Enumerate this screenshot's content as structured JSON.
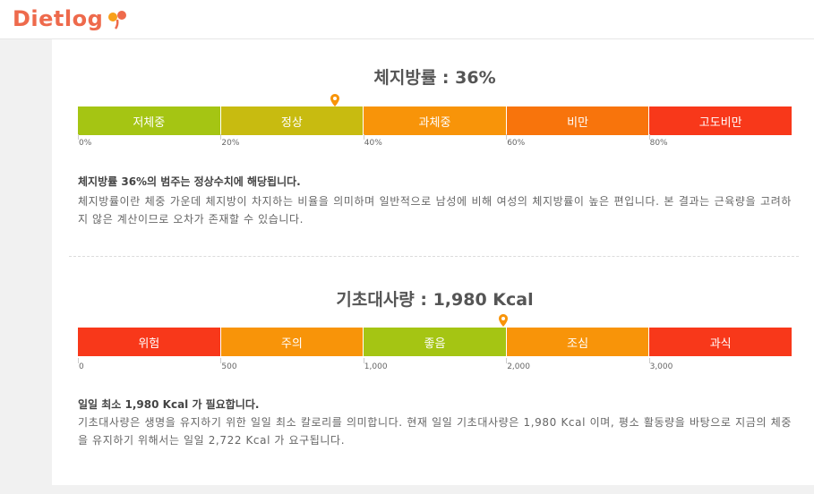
{
  "header": {
    "logo_text": "Dietlog"
  },
  "body_fat": {
    "title": "체지방률 : 36%",
    "marker_value": 36,
    "segments": [
      {
        "label": "저체중",
        "color": "#a5c513"
      },
      {
        "label": "정상",
        "color": "#c8bb10"
      },
      {
        "label": "과체중",
        "color": "#f89409"
      },
      {
        "label": "비만",
        "color": "#f8740c"
      },
      {
        "label": "고도비만",
        "color": "#f8381a"
      }
    ],
    "ticks": [
      "0%",
      "20%",
      "40%",
      "60%",
      "80%"
    ],
    "summary": "체지방률 36%의 범주는 정상수치에 해당됩니다.",
    "description": "체지방률이란 체중 가운데 체지방이 차지하는 비율을 의미하며 일반적으로 남성에 비해 여성의 체지방률이 높은 편입니다. 본 결과는 근육량을 고려하지 않은 계산이므로 오차가 존재할 수 있습니다."
  },
  "bmr": {
    "title": "기초대사량 : 1,980 Kcal",
    "marker_value": 1980,
    "segments": [
      {
        "label": "위험",
        "color": "#f8381a"
      },
      {
        "label": "주의",
        "color": "#f89409"
      },
      {
        "label": "좋음",
        "color": "#a5c513"
      },
      {
        "label": "조심",
        "color": "#f89409"
      },
      {
        "label": "과식",
        "color": "#f8381a"
      }
    ],
    "ticks": [
      "0",
      "500",
      "1,000",
      "2,000",
      "3,000"
    ],
    "summary": "일일 최소 1,980 Kcal 가 필요합니다.",
    "description": "기초대사량은 생명을 유지하기 위한 일일 최소 칼로리를 의미합니다. 현재 일일 기초대사량은 1,980 Kcal 이며, 평소 활동량을 바탕으로 지금의 체중을 유지하기 위해서는 일일 2,722 Kcal 가 요구됩니다."
  }
}
